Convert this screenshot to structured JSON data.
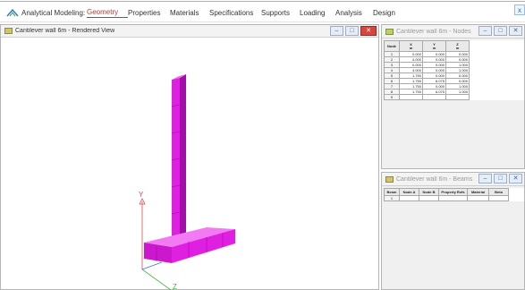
{
  "app": {
    "brand": "Analytical Modeling:",
    "tabs": [
      "Geometry",
      "Properties",
      "Materials",
      "Specifications",
      "Supports",
      "Loading",
      "Analysis",
      "Design"
    ],
    "active_tab": "Geometry",
    "close_label": "x"
  },
  "view": {
    "title": "Cantilever wall 6m - Rendered View",
    "axis_y": "Y",
    "axis_z": "Z",
    "buttons": {
      "minimize": "–",
      "maximize": "□",
      "close": "✕"
    },
    "colors": {
      "model": "#e020e0",
      "axis_y": "#e24a4a",
      "axis_z": "#3dbb3d"
    }
  },
  "nodes": {
    "title": "Cantilever wall 6m - Nodes",
    "buttons": {
      "minimize": "–",
      "maximize": "□",
      "close": "✕"
    },
    "columns": [
      {
        "name": "Node",
        "unit": ""
      },
      {
        "name": "X",
        "unit": "m"
      },
      {
        "name": "Y",
        "unit": "m"
      },
      {
        "name": "Z",
        "unit": "m"
      }
    ],
    "rows": [
      [
        "1",
        "0.000",
        "0.000",
        "0.000"
      ],
      [
        "2",
        "4.000",
        "0.000",
        "0.000"
      ],
      [
        "3",
        "0.000",
        "0.000",
        "1.000"
      ],
      [
        "4",
        "4.000",
        "0.000",
        "1.000"
      ],
      [
        "5",
        "1.750",
        "0.000",
        "0.000"
      ],
      [
        "6",
        "1.750",
        "6.075",
        "0.000"
      ],
      [
        "7",
        "1.750",
        "0.000",
        "1.000"
      ],
      [
        "8",
        "1.750",
        "6.075",
        "1.000"
      ],
      [
        "9",
        "",
        "",
        ""
      ]
    ]
  },
  "beams": {
    "title": "Cantilever wall 6m - Beams",
    "buttons": {
      "minimize": "–",
      "maximize": "□",
      "close": "✕"
    },
    "columns": [
      "Beam",
      "Node A",
      "Node B",
      "Property Refs",
      "Material",
      "Beta"
    ],
    "rows": [
      [
        "1",
        "",
        "",
        "",
        "",
        ""
      ]
    ]
  }
}
